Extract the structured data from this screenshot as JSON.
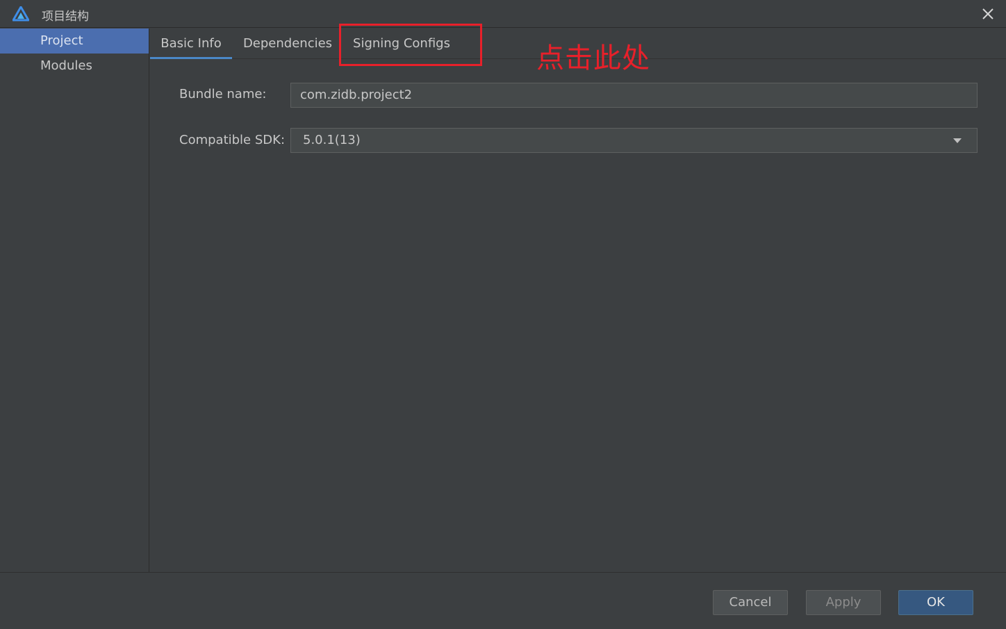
{
  "window": {
    "title": "项目结构",
    "close_icon": "close-icon",
    "logo_icon": "app-logo-icon"
  },
  "sidebar": {
    "items": [
      {
        "label": "Project",
        "selected": true
      },
      {
        "label": "Modules",
        "selected": false
      }
    ]
  },
  "tabs": [
    {
      "label": "Basic Info",
      "active": true
    },
    {
      "label": "Dependencies",
      "active": false
    },
    {
      "label": "Signing Configs",
      "active": false
    }
  ],
  "annotation": {
    "text": "点击此处",
    "color": "#e8202a"
  },
  "form": {
    "bundle_label": "Bundle name:",
    "bundle_value": "com.zidb.project2",
    "sdk_label": "Compatible SDK:",
    "sdk_value": "5.0.1(13)"
  },
  "footer": {
    "cancel": "Cancel",
    "apply": "Apply",
    "ok": "OK"
  },
  "colors": {
    "background": "#3c3f41",
    "selection": "#4b6eaf",
    "accent": "#4a88c7",
    "ok_button": "#365880"
  }
}
